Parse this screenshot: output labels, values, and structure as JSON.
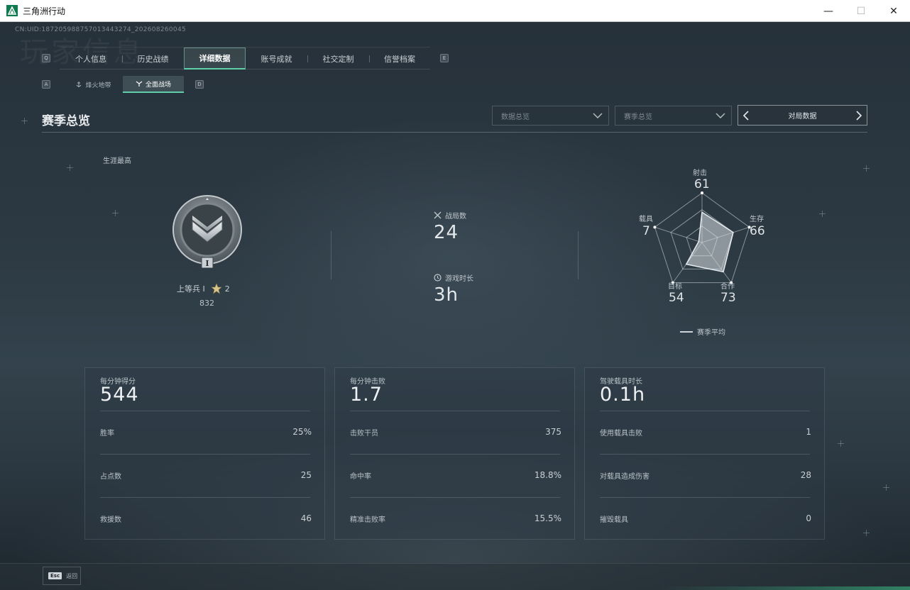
{
  "window": {
    "title": "三角洲行动"
  },
  "uid": "CN:UID:187205988757013443274_202608260045",
  "bg_text": "玩家信息",
  "nav": {
    "key_left": "Q",
    "key_right": "E",
    "tabs": [
      {
        "label": "个人信息"
      },
      {
        "label": "历史战绩"
      },
      {
        "label": "详细数据"
      },
      {
        "label": "账号成就"
      },
      {
        "label": "社交定制"
      },
      {
        "label": "信誉档案"
      }
    ],
    "sub_key_left": "A",
    "sub_key_right": "D",
    "subtabs": [
      {
        "label": "烽火地带"
      },
      {
        "label": "全面战场"
      }
    ]
  },
  "section": {
    "title": "赛季总览"
  },
  "filters": {
    "dropdown1": "数据总览",
    "dropdown2": "赛季总览",
    "match": "对局数据"
  },
  "career": {
    "label": "生涯最高",
    "rank_name": "上等兵 I",
    "stars": "2",
    "score": "832",
    "badge_numeral": "I"
  },
  "summary": {
    "matches_label": "战局数",
    "matches_value": "24",
    "time_label": "游戏时长",
    "time_value": "3h"
  },
  "radar": {
    "axes": [
      {
        "label": "射击",
        "value": "61",
        "v": 61
      },
      {
        "label": "生存",
        "value": "66",
        "v": 66
      },
      {
        "label": "合作",
        "value": "73",
        "v": 73
      },
      {
        "label": "目标",
        "value": "54",
        "v": 54
      },
      {
        "label": "载具",
        "value": "7",
        "v": 7
      }
    ],
    "legend": "赛季平均"
  },
  "cards": [
    {
      "head": "每分钟得分",
      "big": "544",
      "rows": [
        {
          "label": "胜率",
          "value": "25%"
        },
        {
          "label": "占点数",
          "value": "25"
        },
        {
          "label": "救援数",
          "value": "46"
        }
      ]
    },
    {
      "head": "每分钟击败",
      "big": "1.7",
      "rows": [
        {
          "label": "击败干员",
          "value": "375"
        },
        {
          "label": "命中率",
          "value": "18.8%"
        },
        {
          "label": "精准击败率",
          "value": "15.5%"
        }
      ]
    },
    {
      "head": "驾驶载具时长",
      "big": "0.1h",
      "rows": [
        {
          "label": "使用载具击败",
          "value": "1"
        },
        {
          "label": "对载具造成伤害",
          "value": "28"
        },
        {
          "label": "摧毁载具",
          "value": "0"
        }
      ]
    }
  ],
  "bottom": {
    "esc_key": "Esc",
    "esc_label": "返回"
  },
  "colors": {
    "accent": "#5fd0a8",
    "background": "#2c3943"
  }
}
